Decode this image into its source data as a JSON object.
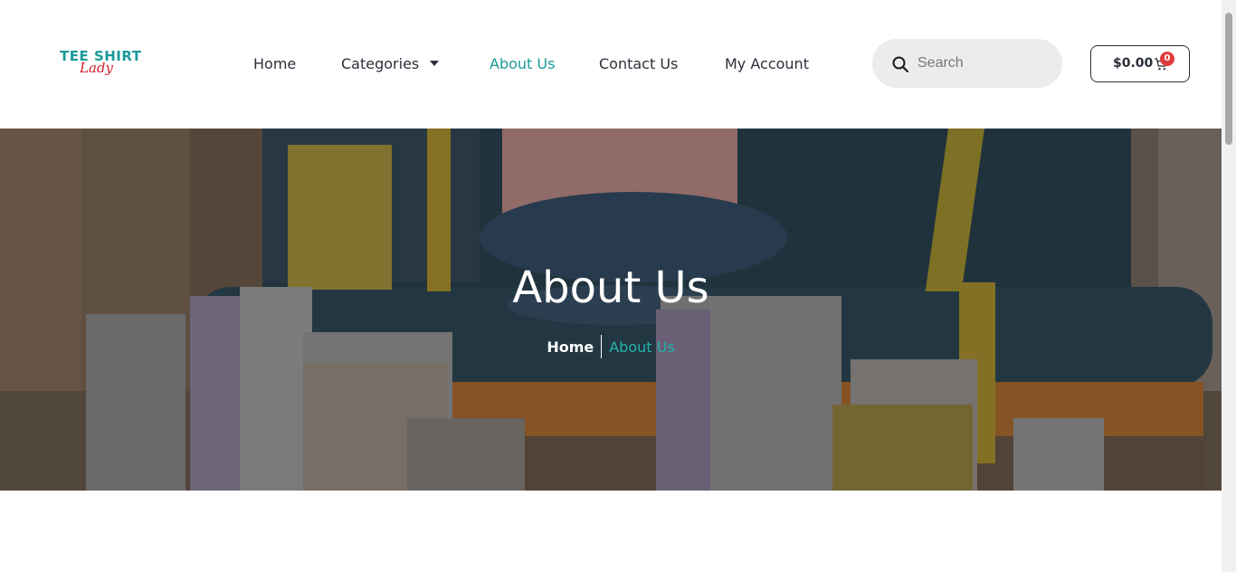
{
  "logo": {
    "line1": "TEE SHIRT",
    "line2": "Lady"
  },
  "nav": {
    "home": "Home",
    "categories": "Categories",
    "about": "About Us",
    "contact": "Contact Us",
    "account": "My Account"
  },
  "search": {
    "placeholder": "Search",
    "value": ""
  },
  "cart": {
    "total": "$0.00",
    "count": "0"
  },
  "hero": {
    "title": "About Us",
    "breadcrumb": {
      "home": "Home",
      "current": "About Us"
    }
  },
  "colors": {
    "accent": "#1a9a98",
    "text": "#2b2f3a",
    "badge": "#e03c3c",
    "logo_red": "#d21f2b"
  }
}
